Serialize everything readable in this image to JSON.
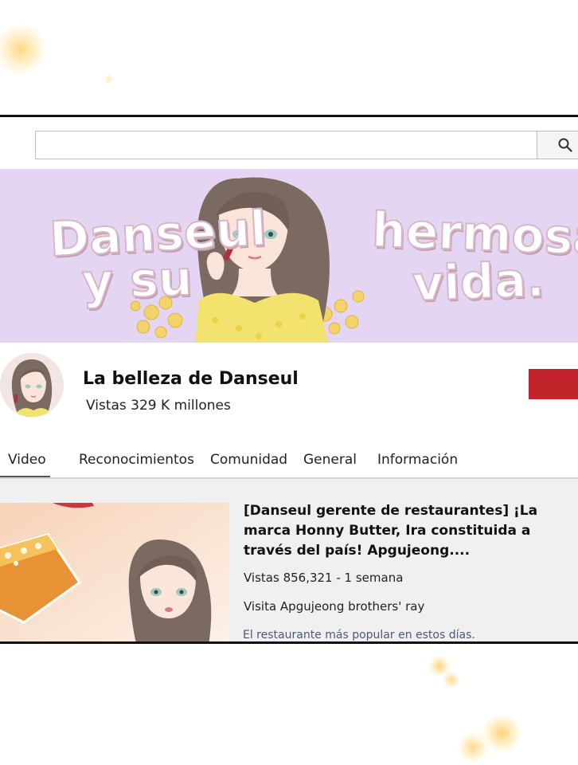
{
  "search": {
    "placeholder": "",
    "icon": "search-icon"
  },
  "banner": {
    "line1": "Danseul",
    "line2": "y su",
    "line3": "hermosa",
    "line4": "vida."
  },
  "channel": {
    "name": "La belleza de Danseul",
    "views": "Vistas 329 K millones"
  },
  "tabs": [
    {
      "label": "Video",
      "active": true
    },
    {
      "label": "Reconocimientos",
      "active": false
    },
    {
      "label": "Comunidad",
      "active": false
    },
    {
      "label": "General",
      "active": false
    },
    {
      "label": "Información",
      "active": false
    }
  ],
  "video": {
    "title": "[Danseul gerente de restaurantes] ¡La marca Honny Butter, Ira constituida a través del país! Apgujeong....",
    "stats": "Vistas 856,321 - 1 semana",
    "description": "Visita Apgujeong brothers' ray",
    "snippet": "El restaurante más popular en estos días."
  },
  "colors": {
    "banner_bg": "#e4d6f3",
    "subscribe": "#c3232a",
    "video_bg": "#f0f0f0"
  }
}
